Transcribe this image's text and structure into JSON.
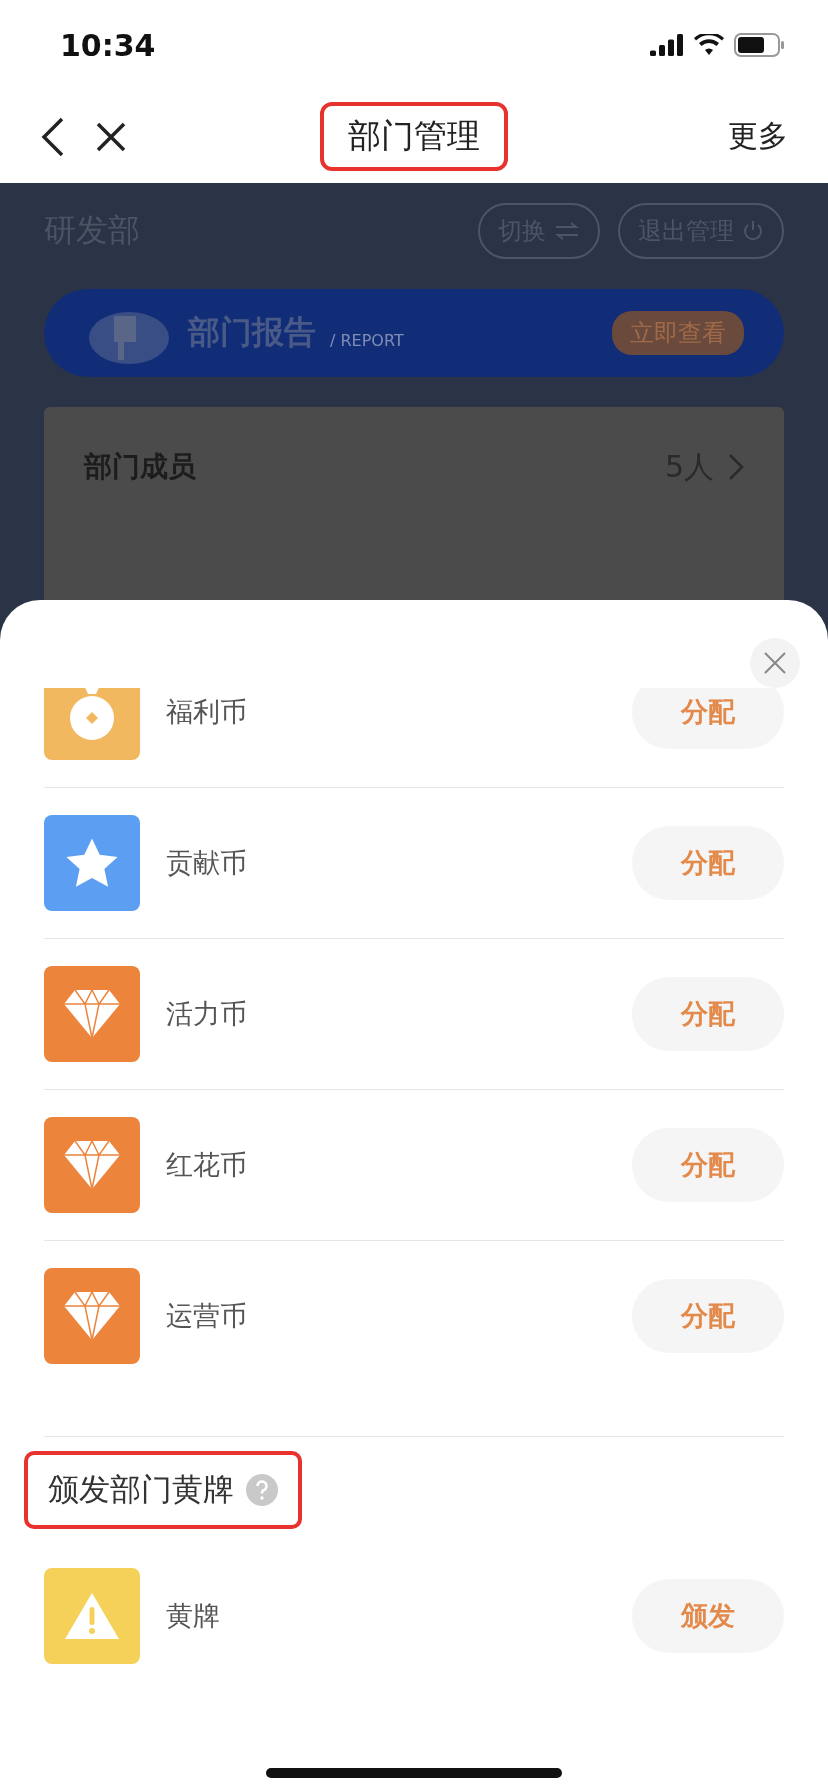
{
  "status_bar": {
    "time": "10:34"
  },
  "nav": {
    "title": "部门管理",
    "title_highlighted": true,
    "more": "更多"
  },
  "background": {
    "department": "研发部",
    "switch_button": "切换",
    "exit_button": "退出管理",
    "report": {
      "title": "部门报告",
      "subtitle": "/ REPORT",
      "action": "立即查看"
    },
    "card": {
      "label": "部门成员",
      "value": "5人"
    }
  },
  "sheet": {
    "coins": [
      {
        "kind": "bag",
        "name": "福利币",
        "action": "分配",
        "color": "#f2b860"
      },
      {
        "kind": "star",
        "name": "贡献币",
        "action": "分配",
        "color": "#5b9ef2"
      },
      {
        "kind": "diamond",
        "name": "活力币",
        "action": "分配",
        "color": "#ec843c"
      },
      {
        "kind": "diamond",
        "name": "红花币",
        "action": "分配",
        "color": "#ec843c"
      },
      {
        "kind": "diamond",
        "name": "运营币",
        "action": "分配",
        "color": "#ec843c"
      }
    ],
    "section": {
      "title": "颁发部门黄牌",
      "highlighted": true
    },
    "cards": [
      {
        "kind": "warning",
        "name": "黄牌",
        "action": "颁发",
        "color": "#f5d15a"
      }
    ]
  }
}
